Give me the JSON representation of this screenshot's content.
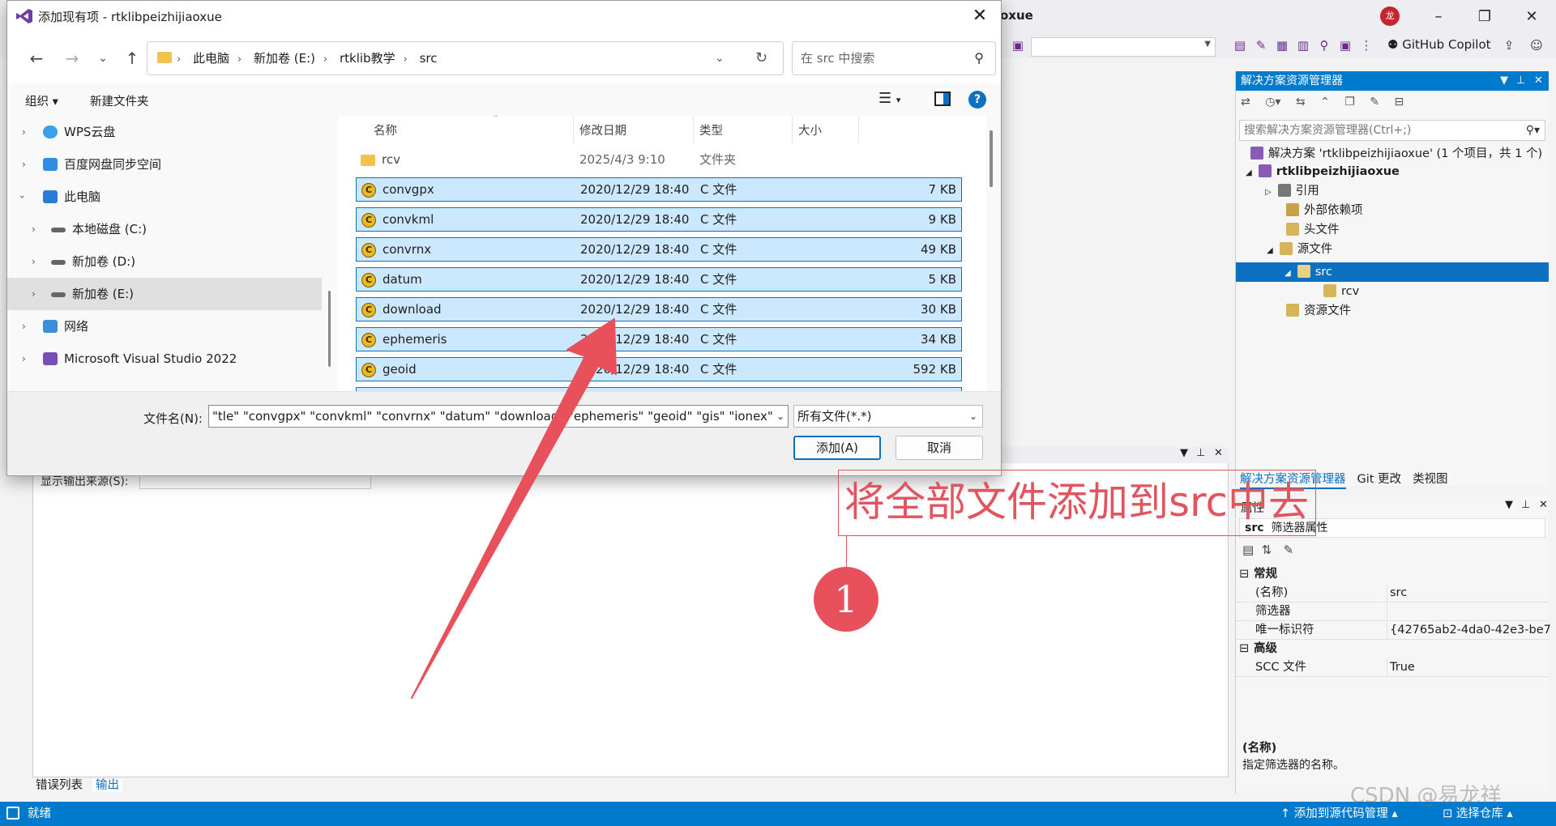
{
  "vs": {
    "title_fragment": "oxue",
    "avatar_char": "龙",
    "copilot_label": "GitHub Copilot",
    "solution_explorer": {
      "title": "解决方案资源管理器",
      "search_placeholder": "搜索解决方案资源管理器(Ctrl+;)",
      "tree": [
        {
          "label": "解决方案 'rtklibpeizhijiaoxue' (1 个项目，共 1 个)"
        },
        {
          "label": "rtklibpeizhijiaoxue"
        },
        {
          "label": "引用"
        },
        {
          "label": "外部依赖项"
        },
        {
          "label": "头文件"
        },
        {
          "label": "源文件"
        },
        {
          "label": "src"
        },
        {
          "label": "rcv"
        },
        {
          "label": "资源文件"
        }
      ],
      "tabs": [
        "解决方案资源管理器",
        "Git 更改",
        "类视图"
      ]
    },
    "properties": {
      "title": "属性",
      "object_bold": "src",
      "object_type": "筛选器属性",
      "categories": [
        {
          "name": "常规",
          "items": [
            {
              "key": "(名称)",
              "value": "src"
            },
            {
              "key": "筛选器",
              "value": ""
            },
            {
              "key": "唯一标识符",
              "value": "{42765ab2-4da0-42e3-be7"
            }
          ]
        },
        {
          "name": "高级",
          "items": [
            {
              "key": "SCC 文件",
              "value": "True"
            }
          ]
        }
      ],
      "desc_title": "(名称)",
      "desc_text": "指定筛选器的名称。"
    },
    "output": {
      "source_label": "显示输出来源(S):",
      "tabs": [
        "错误列表",
        "输出"
      ]
    },
    "status": {
      "ready": "就绪",
      "add_source": "添加到源代码管理",
      "select_repo": "选择仓库"
    },
    "watermark": "CSDN @易龙祥"
  },
  "dialog": {
    "title": "添加现有项 - rtklibpeizhijiaoxue",
    "breadcrumb": [
      "此电脑",
      "新加卷 (E:)",
      "rtklib教学",
      "src"
    ],
    "search_placeholder": "在 src 中搜索",
    "cmd": {
      "organize": "组织 ▾",
      "new_folder": "新建文件夹"
    },
    "nav_items": [
      {
        "label": "WPS云盘"
      },
      {
        "label": "百度网盘同步空间"
      },
      {
        "label": "此电脑"
      },
      {
        "label": "本地磁盘 (C:)"
      },
      {
        "label": "新加卷 (D:)"
      },
      {
        "label": "新加卷 (E:)"
      },
      {
        "label": "网络"
      },
      {
        "label": "Microsoft Visual Studio 2022"
      }
    ],
    "columns": {
      "name": "名称",
      "date": "修改日期",
      "type": "类型",
      "size": "大小"
    },
    "files": [
      {
        "name": "rcv",
        "date": "2025/4/3 9:10",
        "type": "文件夹",
        "size": ""
      },
      {
        "name": "convgpx",
        "date": "2020/12/29 18:40",
        "type": "C 文件",
        "size": "7 KB"
      },
      {
        "name": "convkml",
        "date": "2020/12/29 18:40",
        "type": "C 文件",
        "size": "9 KB"
      },
      {
        "name": "convrnx",
        "date": "2020/12/29 18:40",
        "type": "C 文件",
        "size": "49 KB"
      },
      {
        "name": "datum",
        "date": "2020/12/29 18:40",
        "type": "C 文件",
        "size": "5 KB"
      },
      {
        "name": "download",
        "date": "2020/12/29 18:40",
        "type": "C 文件",
        "size": "30 KB"
      },
      {
        "name": "ephemeris",
        "date": "2020/12/29 18:40",
        "type": "C 文件",
        "size": "34 KB"
      },
      {
        "name": "geoid",
        "date": "2020/12/29 18:40",
        "type": "C 文件",
        "size": "592 KB"
      }
    ],
    "filename_label": "文件名(N):",
    "filename_value": "\"tle\" \"convgpx\" \"convkml\" \"convrnx\" \"datum\" \"download\" \"ephemeris\" \"geoid\" \"gis\" \"ionex\"",
    "filetype": "所有文件(*.*)",
    "add_button": "添加(A)",
    "cancel_button": "取消"
  },
  "annotation": {
    "text": "将全部文件添加到src中去",
    "number": "1",
    "color": "#e05560"
  }
}
